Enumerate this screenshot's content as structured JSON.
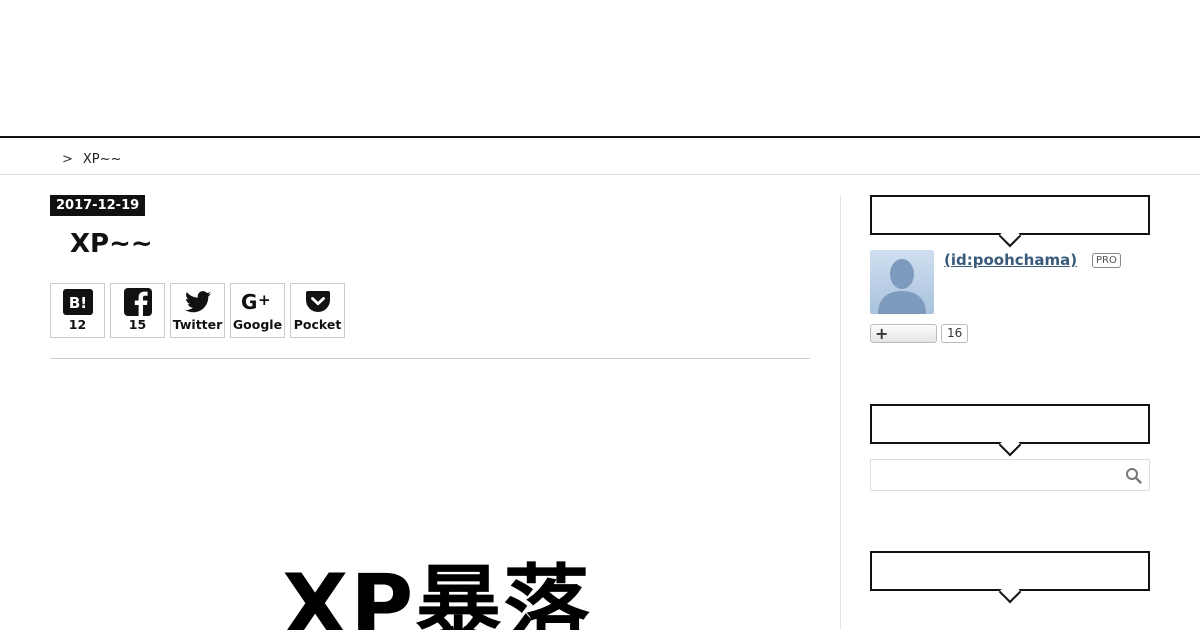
{
  "breadcrumb": {
    "home_label": "",
    "separator": ">",
    "current": "XP~~"
  },
  "entry": {
    "date": "2017-12-19",
    "title": "XP~~",
    "hero_text": "XP暴落"
  },
  "share": {
    "hatena": {
      "icon": "hatena-bookmark-icon",
      "count": "12"
    },
    "facebook": {
      "icon": "facebook-icon",
      "count": "15"
    },
    "twitter": {
      "icon": "twitter-icon",
      "label": "Twitter"
    },
    "google": {
      "icon": "google-plus-icon",
      "label": "Google"
    },
    "pocket": {
      "icon": "pocket-icon",
      "label": "Pocket"
    }
  },
  "sidebar": {
    "profile": {
      "name": " (id:poohchama)",
      "badge": "PRO",
      "follow_symbol": "+",
      "follower_count": "16"
    },
    "search": {
      "placeholder": ""
    }
  },
  "colors": {
    "link": "#3a5a7a",
    "badge_bg": "#111111",
    "border": "#111111"
  }
}
